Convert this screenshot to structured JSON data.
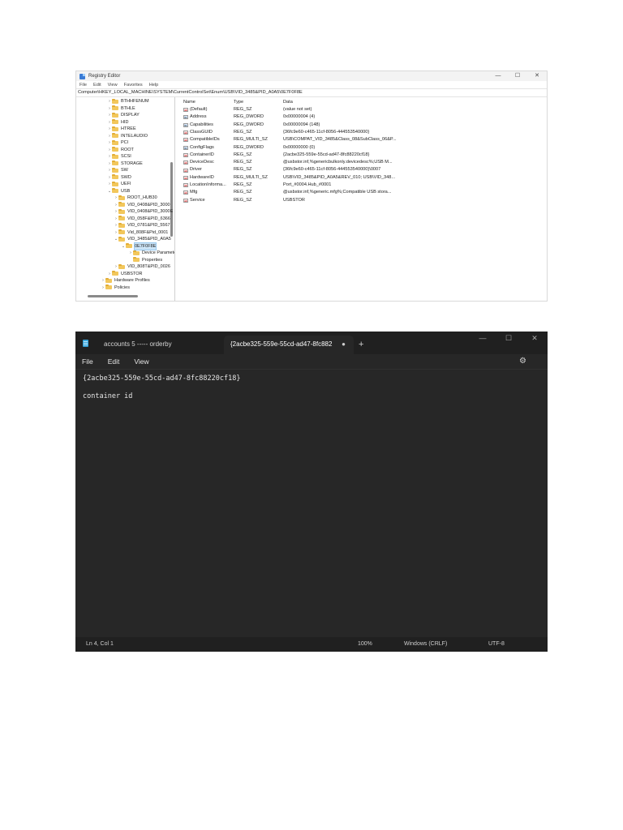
{
  "registry": {
    "title": "Registry Editor",
    "window_controls": [
      "—",
      "☐",
      "✕"
    ],
    "menu": [
      "File",
      "Edit",
      "View",
      "Favorites",
      "Help"
    ],
    "address": "Computer\\HKEY_LOCAL_MACHINE\\SYSTEM\\CurrentControlSet\\Enum\\USB\\VID_3485&PID_A0A5\\0E7F0F8E",
    "tree": [
      {
        "label": "BTHHFENUM",
        "level": 1,
        "chevron": "›"
      },
      {
        "label": "BTHLE",
        "level": 1,
        "chevron": "›"
      },
      {
        "label": "DISPLAY",
        "level": 1,
        "chevron": "›"
      },
      {
        "label": "HID",
        "level": 1,
        "chevron": "›"
      },
      {
        "label": "HTREE",
        "level": 1,
        "chevron": "›"
      },
      {
        "label": "INTELAUDIO",
        "level": 1,
        "chevron": "›"
      },
      {
        "label": "PCI",
        "level": 1,
        "chevron": "›"
      },
      {
        "label": "ROOT",
        "level": 1,
        "chevron": "›"
      },
      {
        "label": "SCSI",
        "level": 1,
        "chevron": "›"
      },
      {
        "label": "STORAGE",
        "level": 1,
        "chevron": "›"
      },
      {
        "label": "SW",
        "level": 1,
        "chevron": "›"
      },
      {
        "label": "SWD",
        "level": 1,
        "chevron": "›"
      },
      {
        "label": "UEFI",
        "level": 1,
        "chevron": "›"
      },
      {
        "label": "USB",
        "level": 1,
        "chevron": "⌄"
      },
      {
        "label": "ROOT_HUB30",
        "level": 2,
        "chevron": "›"
      },
      {
        "label": "VID_0408&PID_3000",
        "level": 2,
        "chevron": "›"
      },
      {
        "label": "VID_0408&PID_3000E",
        "level": 2,
        "chevron": "›"
      },
      {
        "label": "VID_058F&PID_6366",
        "level": 2,
        "chevron": "›"
      },
      {
        "label": "VID_0781&PID_5567",
        "level": 2,
        "chevron": "›"
      },
      {
        "label": "Vid_808F&Pid_0001",
        "level": 2,
        "chevron": "›"
      },
      {
        "label": "VID_3485&PID_A0A5",
        "level": 2,
        "chevron": "⌄"
      },
      {
        "label": "0E7F0F8E",
        "level": 3,
        "chevron": "⌄",
        "selected": true
      },
      {
        "label": "Device Parameters",
        "level": 4,
        "chevron": "›"
      },
      {
        "label": "Properties",
        "level": 4,
        "chevron": ""
      },
      {
        "label": "VID_808T&PID_0026",
        "level": 2,
        "chevron": "›"
      },
      {
        "label": "USBSTOR",
        "level": 1,
        "chevron": "›"
      },
      {
        "label": "Hardware Profiles",
        "level": 0,
        "chevron": "›"
      },
      {
        "label": "Policies",
        "level": 0,
        "chevron": "›"
      }
    ],
    "columns": [
      "Name",
      "Type",
      "Data"
    ],
    "values": [
      {
        "name": "(Default)",
        "type": "REG_SZ",
        "data": "(value not set)",
        "icon": "ab"
      },
      {
        "name": "Address",
        "type": "REG_DWORD",
        "data": "0x00000004 (4)",
        "icon": "bin"
      },
      {
        "name": "Capabilities",
        "type": "REG_DWORD",
        "data": "0x00000094 (148)",
        "icon": "bin"
      },
      {
        "name": "ClassGUID",
        "type": "REG_SZ",
        "data": "{36fc9e60-c465-11cf-8056-444553540000}",
        "icon": "ab"
      },
      {
        "name": "CompatibleIDs",
        "type": "REG_MULTI_SZ",
        "data": "USB\\COMPAT_VID_3485&Class_08&SubClass_06&P...",
        "icon": "ab"
      },
      {
        "name": "ConfigFlags",
        "type": "REG_DWORD",
        "data": "0x00000000 (0)",
        "icon": "bin"
      },
      {
        "name": "ContainerID",
        "type": "REG_SZ",
        "data": "{2acbe325-559e-55cd-ad47-8fc88220cf18}",
        "icon": "ab"
      },
      {
        "name": "DeviceDesc",
        "type": "REG_SZ",
        "data": "@usbstor.inf,%genericbulkonly.devicedesc%;USB M...",
        "icon": "ab"
      },
      {
        "name": "Driver",
        "type": "REG_SZ",
        "data": "{36fc9e60-c465-11cf-8056-444553540000}\\0007",
        "icon": "ab"
      },
      {
        "name": "HardwareID",
        "type": "REG_MULTI_SZ",
        "data": "USB\\VID_3485&PID_A0A5&REV_010; USB\\VID_348...",
        "icon": "ab"
      },
      {
        "name": "LocationInforma...",
        "type": "REG_SZ",
        "data": "Port_#0004.Hub_#0001",
        "icon": "ab"
      },
      {
        "name": "Mfg",
        "type": "REG_SZ",
        "data": "@usbstor.inf,%generic.mfg%;Compatible USB stora...",
        "icon": "ab"
      },
      {
        "name": "Service",
        "type": "REG_SZ",
        "data": "USBSTOR",
        "icon": "ab"
      }
    ]
  },
  "notepad": {
    "tabs": [
      {
        "label": "accounts 5 ----- orderby"
      },
      {
        "label": "{2acbe325-559e-55cd-ad47-8fc882",
        "modified_dot": "●"
      }
    ],
    "new_tab": "+",
    "window_controls": [
      "—",
      "☐",
      "✕"
    ],
    "menu": [
      "File",
      "Edit",
      "View"
    ],
    "gear": "⚙",
    "lines": [
      "{2acbe325-559e-55cd-ad47-8fc88220cf18}",
      "",
      "container id"
    ],
    "status": {
      "position": "Ln 4, Col 1",
      "zoom": "100%",
      "line_ending": "Windows (CRLF)",
      "encoding": "UTF-8"
    }
  }
}
